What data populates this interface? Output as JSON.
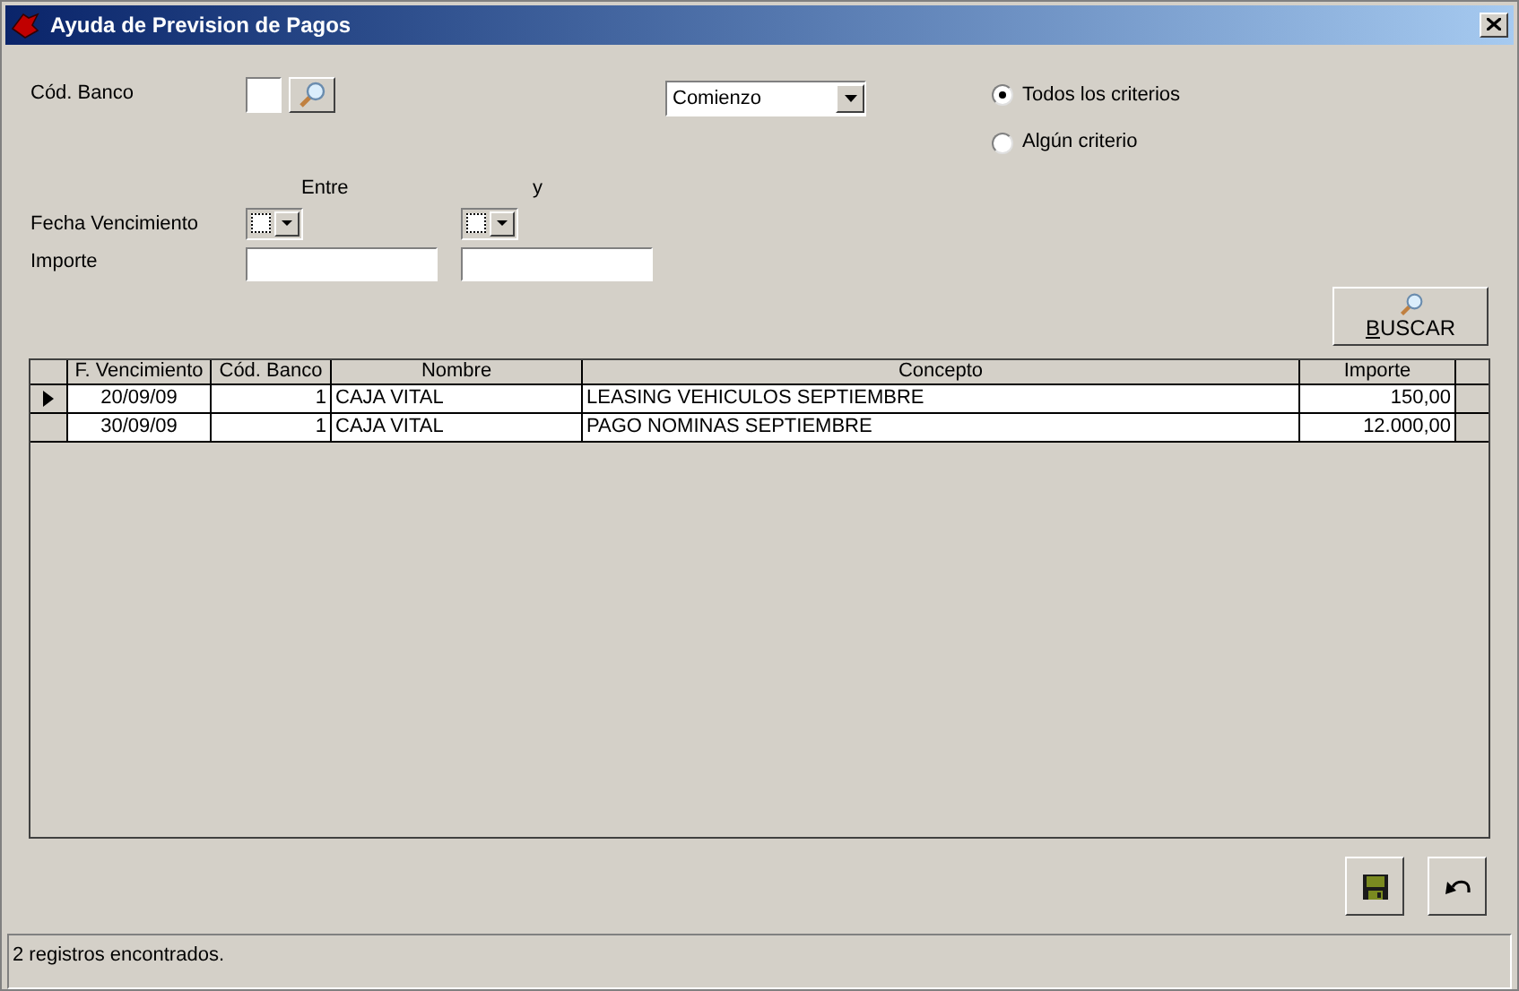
{
  "window": {
    "title": "Ayuda de Prevision de Pagos"
  },
  "form": {
    "banco_label": "Cód. Banco",
    "match_combo": "Comienzo",
    "between_label": "Entre",
    "and_label": "y",
    "fecha_label": "Fecha Vencimiento",
    "fecha_from": {
      "checked": false
    },
    "fecha_to": {
      "checked": false
    },
    "importe_label": "Importe"
  },
  "criteria": [
    {
      "label": "Todos los criterios",
      "selected": true
    },
    {
      "label": "Algún criterio",
      "selected": false
    }
  ],
  "search_button": "BUSCAR",
  "table": {
    "columns": [
      "F. Vencimiento",
      "Cód. Banco",
      "Nombre",
      "Concepto",
      "Importe"
    ],
    "rows": [
      {
        "selected": true,
        "cells": [
          "20/09/09",
          "1",
          "CAJA VITAL",
          "LEASING VEHICULOS SEPTIEMBRE",
          "150,00"
        ]
      },
      {
        "selected": false,
        "cells": [
          "30/09/09",
          "1",
          "CAJA VITAL",
          "PAGO NOMINAS SEPTIEMBRE",
          "12.000,00"
        ]
      }
    ]
  },
  "status_bar": "2 registros encontrados."
}
